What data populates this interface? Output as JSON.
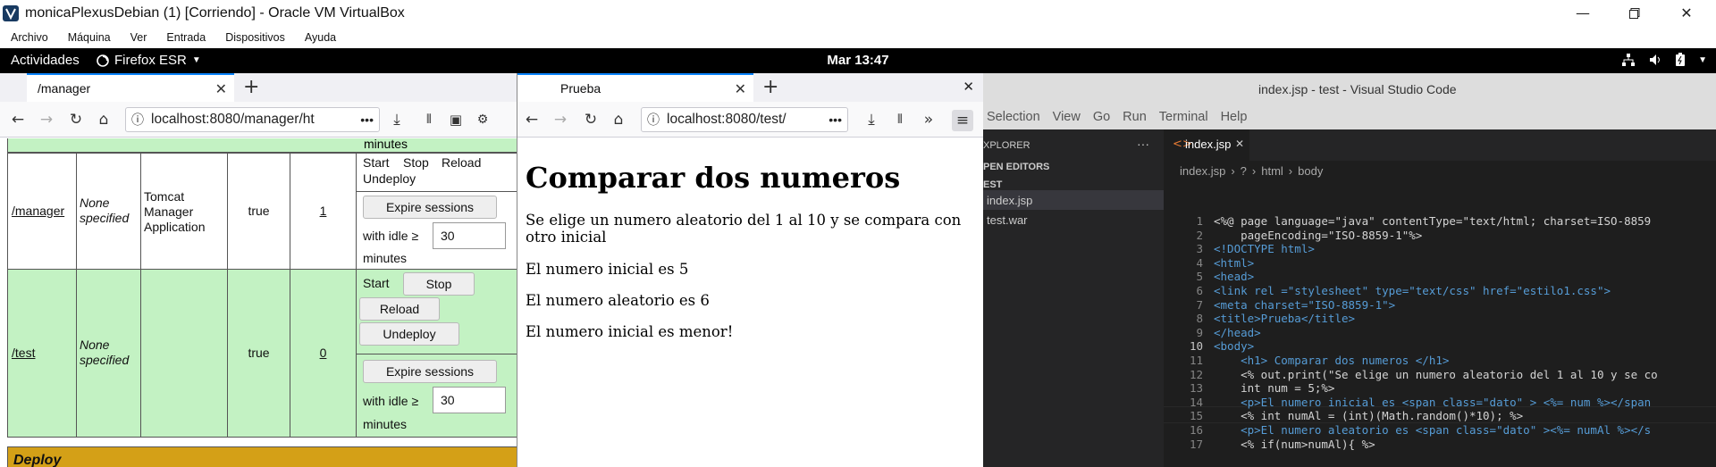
{
  "vbox": {
    "title": "monicaPlexusDebian (1) [Corriendo] - Oracle VM VirtualBox",
    "menu": [
      "Archivo",
      "Máquina",
      "Ver",
      "Entrada",
      "Dispositivos",
      "Ayuda"
    ]
  },
  "gnome": {
    "activities": "Actividades",
    "app": "Firefox ESR",
    "clock": "Mar 13:47"
  },
  "manager": {
    "tab": "/manager",
    "url": "localhost:8080/manager/ht",
    "rows": [
      {
        "path": "/manager",
        "version": "None specified",
        "display_name": "Tomcat Manager Application",
        "running": "true",
        "sessions": "1",
        "commands": [
          "Start",
          "Stop",
          "Reload",
          "Undeploy"
        ],
        "expire_label": "Expire sessions",
        "idle_label": "with idle ≥",
        "idle_value": "30",
        "minutes": "minutes"
      },
      {
        "path": "/test",
        "version": "None specified",
        "display_name": "",
        "running": "true",
        "sessions": "0",
        "commands": [
          "Start",
          "Stop",
          "Reload",
          "Undeploy"
        ],
        "expire_label": "Expire sessions",
        "idle_label": "with idle ≥",
        "idle_value": "30",
        "minutes": "minutes"
      }
    ],
    "top_minutes": "minutes",
    "deploy": "Deploy"
  },
  "prueba": {
    "tab": "Prueba",
    "url": "localhost:8080/test/",
    "h1": "Comparar dos numeros",
    "p1": "Se elige un numero aleatorio del 1 al 10 y se compara con otro inicial",
    "p2": "El numero inicial es 5",
    "p3": "El numero aleatorio es 6",
    "p4": "El numero inicial es menor!"
  },
  "vscode": {
    "title": "index.jsp - test - Visual Studio Code",
    "menu": [
      "Selection",
      "View",
      "Go",
      "Run",
      "Terminal",
      "Help"
    ],
    "explorer": "XPLORER",
    "open_editors": "PEN EDITORS",
    "folder": "EST",
    "files": [
      "index.jsp",
      "test.war"
    ],
    "tab": "index.jsp",
    "breadcrumb": [
      "index.jsp",
      "?",
      "html",
      "body"
    ],
    "lines": [
      "<%@ page language=\"java\" contentType=\"text/html; charset=ISO-8859",
      "    pageEncoding=\"ISO-8859-1\"%>",
      "<!DOCTYPE html>",
      "<html>",
      "<head>",
      "<link rel =\"stylesheet\" type=\"text/css\" href=\"estilo1.css\">",
      "<meta charset=\"ISO-8859-1\">",
      "<title>Prueba</title>",
      "</head>",
      "<body>",
      "    <h1> Comparar dos numeros </h1>",
      "    <% out.print(\"Se elige un numero aleatorio del 1 al 10 y se co",
      "    int num = 5;%>",
      "    <p>El numero inicial es <span class=\"dato\" > <%= num %></span",
      "    <% int numAl = (int)(Math.random()*10); %>",
      "    <p>El numero aleatorio es <span class=\"dato\" ><%= numAl %></s",
      "    <% if(num>numAl){ %>"
    ],
    "line_numbers": [
      "1",
      "2",
      "3",
      "4",
      "5",
      "6",
      "7",
      "8",
      "9",
      "10",
      "11",
      "12",
      "13",
      "14",
      "15",
      "16",
      "17"
    ],
    "active_line": "10"
  },
  "colors": {
    "tomcat_green": "#c3f2c3",
    "firefox_accent": "#0a84ff",
    "vscode_bg": "#1e1e1e"
  }
}
